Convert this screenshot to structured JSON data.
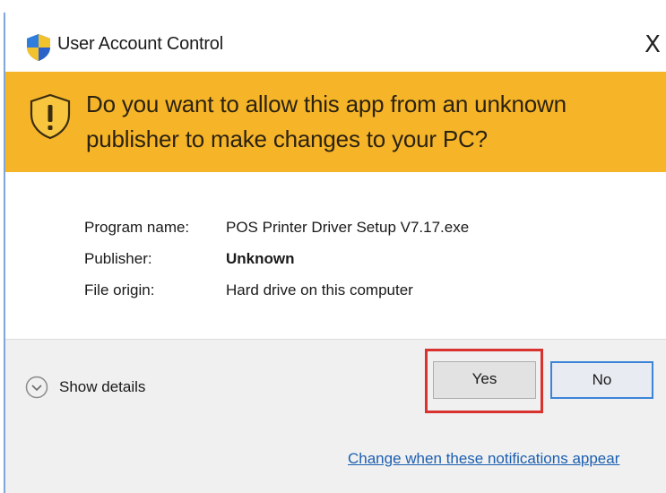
{
  "window": {
    "title": "User Account Control",
    "close_glyph": "X",
    "shield_icon": "uac-shield-icon",
    "warning_icon": "warning-shield-icon"
  },
  "banner": {
    "line1": "Do you want to allow this app from an unknown",
    "line2": "publisher to make changes to your PC?",
    "color": "#f6b529"
  },
  "info": [
    {
      "label": "Program name:",
      "value": "POS Printer Driver Setup V7.17.exe"
    },
    {
      "label": "Publisher:",
      "value": "Unknown"
    },
    {
      "label": "File origin:",
      "value": "Hard drive on this computer"
    }
  ],
  "footer": {
    "show_details_label": "Show details",
    "yes_label": "Yes",
    "no_label": "No",
    "notifications_link": "Change when these notifications appear",
    "highlight_color": "#d8332f"
  }
}
